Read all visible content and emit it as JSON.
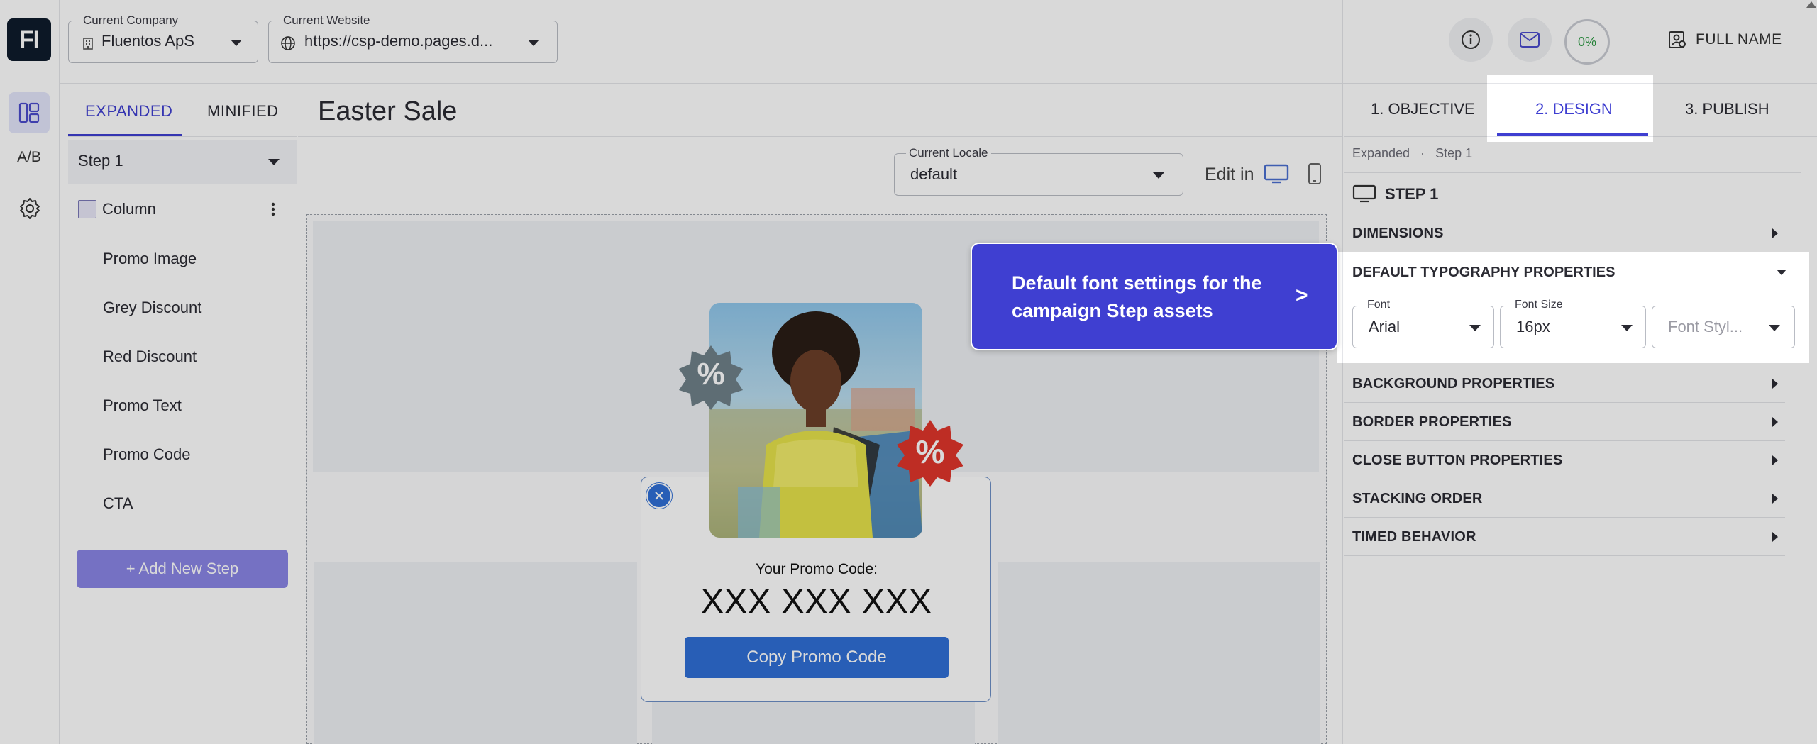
{
  "app": {
    "logo": "FI"
  },
  "header": {
    "company": {
      "label": "Current Company",
      "value": "Fluentos ApS"
    },
    "website": {
      "label": "Current Website",
      "value": "https://csp-demo.pages.d..."
    },
    "progress": "0%",
    "user_name": "FULL NAME"
  },
  "rail": {
    "ab_label": "A/B"
  },
  "layers": {
    "tabs": [
      "EXPANDED",
      "MINIFIED"
    ],
    "active_tab": "EXPANDED",
    "step_select": "Step 1",
    "column_label": "Column",
    "items": [
      "Promo Image",
      "Grey Discount",
      "Red Discount",
      "Promo Text",
      "Promo Code",
      "CTA"
    ],
    "add_step": "+ Add New Step"
  },
  "canvas": {
    "title": "Easter Sale",
    "locale": {
      "label": "Current Locale",
      "value": "default"
    },
    "edit_in": "Edit in",
    "popup": {
      "badge_left": "%",
      "badge_right": "%",
      "promo_label": "Your Promo Code:",
      "promo_code": "XXX XXX XXX",
      "cta": "Copy Promo Code"
    }
  },
  "design_panel": {
    "steps": [
      "1. OBJECTIVE",
      "2. DESIGN",
      "3. PUBLISH"
    ],
    "active_step": "2. DESIGN",
    "breadcrumb": [
      "Expanded",
      "Step 1"
    ],
    "section_title": "STEP 1",
    "sections": [
      "DIMENSIONS",
      "DEFAULT TYPOGRAPHY PROPERTIES",
      "BACKGROUND PROPERTIES",
      "BORDER PROPERTIES",
      "CLOSE BUTTON PROPERTIES",
      "STACKING ORDER",
      "TIMED BEHAVIOR"
    ],
    "typography": {
      "font": {
        "label": "Font",
        "value": "Arial"
      },
      "font_size": {
        "label": "Font Size",
        "value": "16px"
      },
      "font_style": {
        "placeholder": "Font Styl..."
      }
    }
  },
  "tooltip": {
    "text": "Default font settings for the campaign Step assets",
    "arrow": ">"
  },
  "colors": {
    "accent": "#3f3fd1",
    "cta_blue": "#2f6fd6",
    "badge_grey": "#6f8089",
    "badge_red": "#e0352b",
    "add_step": "#8a85e6"
  }
}
